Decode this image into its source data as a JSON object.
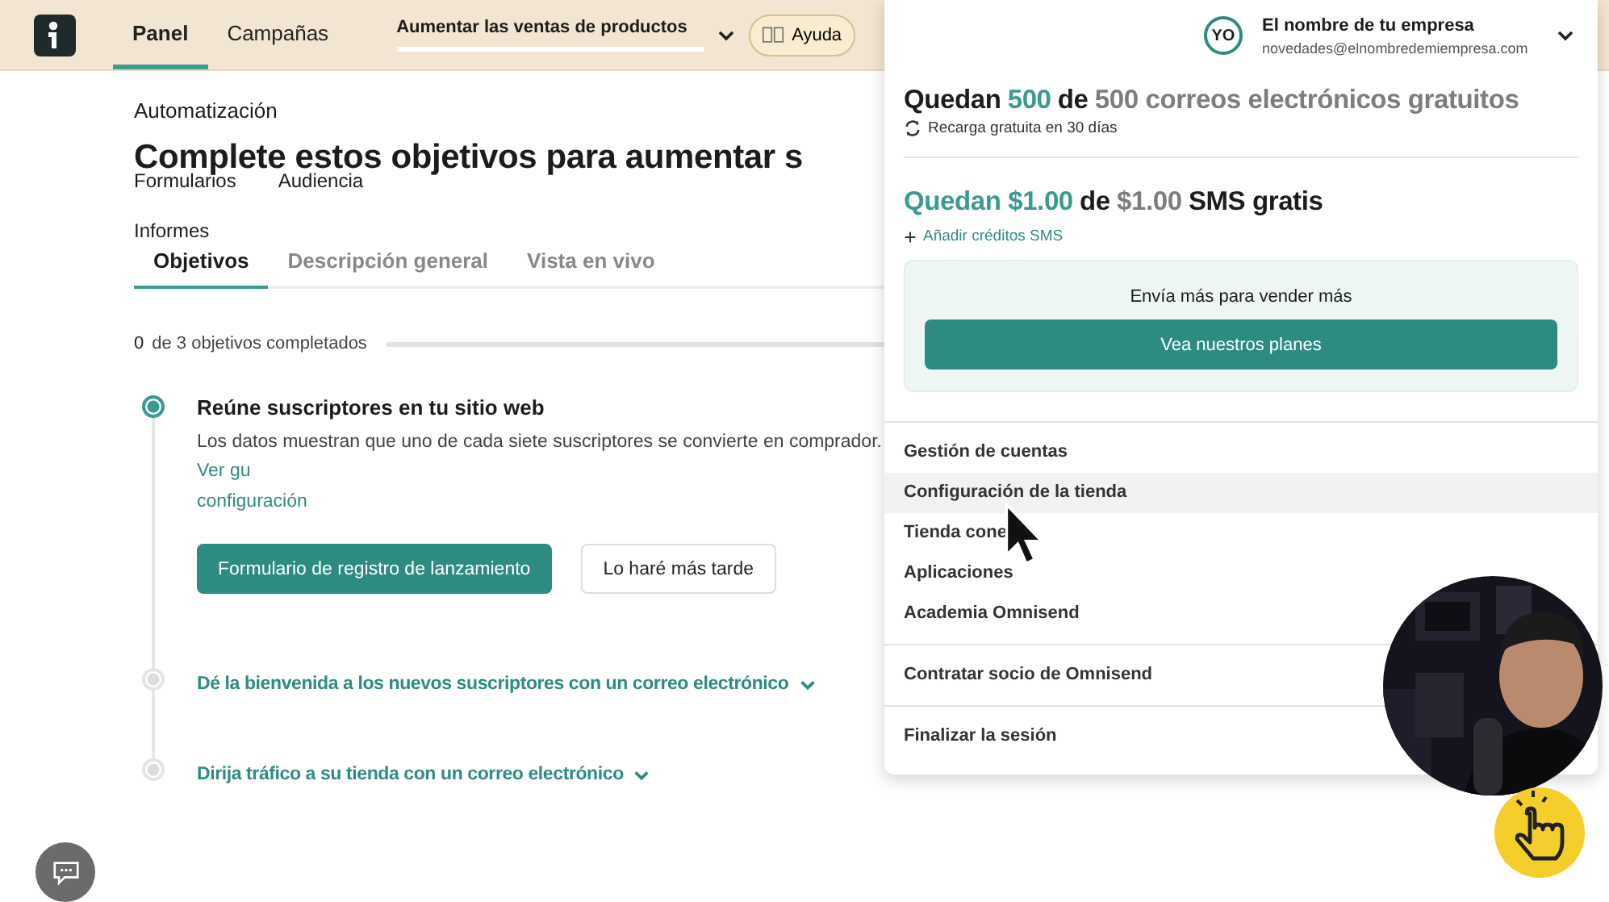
{
  "header": {
    "nav": [
      {
        "label": "Panel",
        "selected": true
      },
      {
        "label": "Campañas",
        "selected": false
      }
    ],
    "goal_select": {
      "value": "Aumentar las ventas de productos"
    },
    "help_button": "Ayuda"
  },
  "breadcrumb": "Automatización",
  "heading": "Complete estos objetivos para aumentar s",
  "ghost_links": [
    "Formularios",
    "Audiencia"
  ],
  "ghost_tab": "Informes",
  "tabs": [
    {
      "label": "Objetivos",
      "selected": true
    },
    {
      "label": "Descripción general",
      "selected": false
    },
    {
      "label": "Vista en vivo",
      "selected": false
    }
  ],
  "progress": {
    "count": "0",
    "label": "de 3 objetivos completados"
  },
  "steps": [
    {
      "kind": "active",
      "title": "Reúne suscriptores en tu sitio web",
      "description": "Los datos muestran que uno de cada siete suscriptores se convierte en comprador.",
      "link_parts": [
        "Ver gu",
        "configuración"
      ],
      "primary_button": "Formulario de registro de lanzamiento",
      "secondary_button": "Lo haré más tarde"
    },
    {
      "kind": "collapsed",
      "title": "Dé la bienvenida a los nuevos suscriptores con un correo electrónico"
    },
    {
      "kind": "collapsed",
      "title": "Dirija tráfico a su tienda con un correo electrónico"
    }
  ],
  "account_menu": {
    "avatar": "YO",
    "name": "El nombre de tu empresa",
    "email": "novedades@elnombredemiempresa.com",
    "email_quota": [
      {
        "text": "Quedan",
        "color": "#1c1c1c"
      },
      {
        "text": "500",
        "color": "#3a9a90"
      },
      {
        "text": "de",
        "color": "#1c1c1c"
      },
      {
        "text": "500 correos electrónicos gratuitos",
        "color": "#7d7d7d"
      }
    ],
    "refill_note": "Recarga gratuita en 30 días",
    "sms_quota": [
      {
        "text": "Quedan $1.00",
        "color": "#3a9a90"
      },
      {
        "text": "de",
        "color": "#1c1c1c"
      },
      {
        "text": "$1.00",
        "color": "#7d7d7d"
      },
      {
        "text": "SMS gratis",
        "color": "#1c1c1c"
      }
    ],
    "add_sms_link": "Añadir créditos SMS",
    "promo": {
      "text": "Envía más para vender más",
      "button": "Vea nuestros planes"
    },
    "groups": [
      [
        {
          "label": "Gestión de cuentas",
          "selected": false
        },
        {
          "label": "Configuración de la tienda",
          "selected": true
        },
        {
          "label": "Tienda cone",
          "selected": false
        },
        {
          "label": "Aplicaciones",
          "selected": false
        },
        {
          "label": "Academia Omnisend",
          "selected": false
        }
      ],
      [
        {
          "label": "Contratar socio de Omnisend",
          "selected": false
        }
      ],
      [
        {
          "label": "Finalizar la sesión",
          "selected": false
        }
      ]
    ]
  },
  "webcam": {
    "kind": "picture"
  }
}
